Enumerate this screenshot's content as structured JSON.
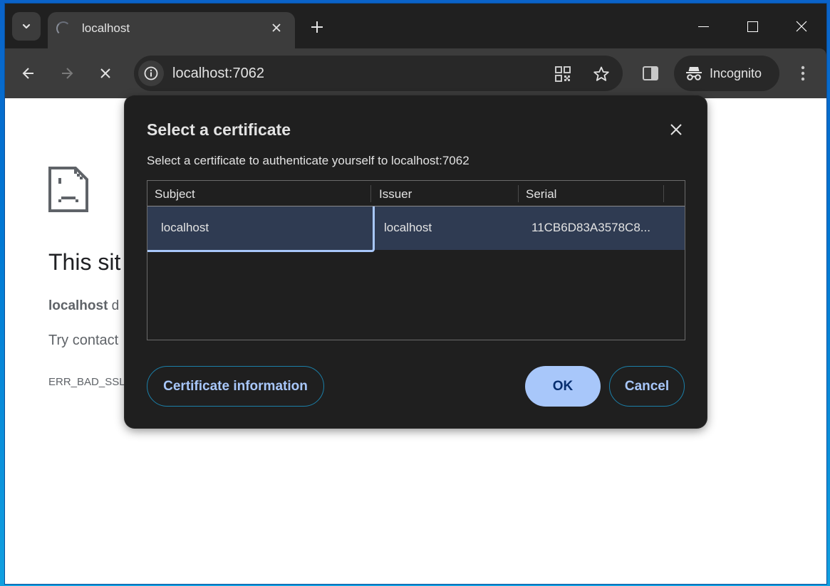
{
  "browser": {
    "tab": {
      "title": "localhost",
      "loading": true
    },
    "address_bar": {
      "url": "localhost:7062"
    },
    "profile_label": "Incognito",
    "icons": {
      "tab_search": "chevron-down-icon",
      "tab_close": "close-icon",
      "new_tab": "plus-icon",
      "back": "arrow-left-icon",
      "forward": "arrow-right-icon",
      "stop": "close-icon",
      "site_info": "info-icon",
      "qr": "qr-code-icon",
      "bookmark": "star-icon",
      "side_panel": "side-panel-icon",
      "incognito": "incognito-icon",
      "menu": "kebab-menu-icon"
    }
  },
  "page": {
    "title": "This sit",
    "line1_bold": "localhost",
    "line1_rest": " d",
    "line2": "Try contact",
    "error_code": "ERR_BAD_SSL"
  },
  "dialog": {
    "title": "Select a certificate",
    "description": "Select a certificate to authenticate yourself to localhost:7062",
    "columns": [
      "Subject",
      "Issuer",
      "Serial"
    ],
    "rows": [
      {
        "subject": "localhost",
        "issuer": "localhost",
        "serial": "11CB6D83A3578C8...",
        "selected": true
      }
    ],
    "buttons": {
      "info": "Certificate information",
      "ok": "OK",
      "cancel": "Cancel"
    },
    "colors": {
      "accent": "#a8c7fa",
      "selected_row": "#2f3b52",
      "background": "#1f1f1f"
    }
  }
}
